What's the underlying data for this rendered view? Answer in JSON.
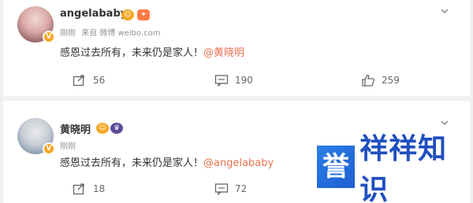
{
  "posts": [
    {
      "username": "angelababy",
      "meta_time": "刚刚",
      "meta_from": "来自 微博 weibo.com",
      "text_prefix": "感恩过去所有，未来仍是家人！",
      "mention": "@黄晓明",
      "reposts": "56",
      "comments": "190",
      "likes": "259"
    },
    {
      "username": "黄晓明",
      "meta_time": "刚刚",
      "text_prefix": "感恩过去所有，未来仍是家人！",
      "mention": "@angelababy",
      "reposts": "18",
      "comments": "72"
    }
  ],
  "watermark": {
    "tile": "誉",
    "rest": "祥祥知识"
  },
  "icons": {
    "repost": "repost-icon",
    "comment": "comment-icon",
    "like": "thumbs-up-icon",
    "more": "chevron-down-icon",
    "verified": "verified-v-icon"
  },
  "colors": {
    "mention": "#eb7350",
    "verified": "#f5a623",
    "brand": "#1f5fd1"
  }
}
